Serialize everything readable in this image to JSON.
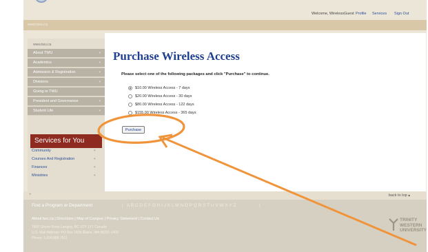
{
  "site": {
    "url_banner": "www.twu.ca",
    "welcome": "Welcome, WirelessGuest",
    "profile_link": "Profile",
    "services_link": "Services",
    "signout_link": "Sign Out"
  },
  "sidebar": {
    "url": "www.twu.ca",
    "items": [
      {
        "label": "About TWU"
      },
      {
        "label": "Academics"
      },
      {
        "label": "Admission & Registration"
      },
      {
        "label": "Divisions"
      },
      {
        "label": "Giving to TWU"
      },
      {
        "label": "President and Governance"
      },
      {
        "label": "Student Life"
      }
    ],
    "services_title": "Services for You",
    "services_items": [
      {
        "label": "Community"
      },
      {
        "label": "Courses And Registration"
      },
      {
        "label": "Finances"
      },
      {
        "label": "Ministries"
      }
    ]
  },
  "main": {
    "title": "Purchase Wireless Access",
    "instruction": "Please select one of the following packages and click \"Purchase\" to continue.",
    "options": [
      {
        "label": "$10.00 Wireless Access - 7 days",
        "selected": true
      },
      {
        "label": "$20.00 Wireless Access - 30 days",
        "selected": false
      },
      {
        "label": "$80.00 Wireless Access - 122 days",
        "selected": false
      },
      {
        "label": "$155.00 Wireless Access - 365 days",
        "selected": false
      }
    ],
    "purchase_label": "Purchase"
  },
  "totop": {
    "plus": "+",
    "back_label": "back to top ▴"
  },
  "footer": {
    "find_label": "Find a Program or Department",
    "separator": "|",
    "letters": "A B C D E F G H I J K L M N O P Q R S T U V W X Y Z",
    "end_separator": "|",
    "links": "About twu.ca | Directions | Map of Campus | Privacy Statement | Contact Us",
    "address1": "7600 Glover Road Langley, BC V2Y 1Y1 Canada",
    "address2": "U.S. Mail Address: PO Box 1409 Blaine, WA 98231-1409",
    "phone": "Phone: 1.604.888.7511",
    "logo_text": [
      "TRINITY",
      "WESTERN",
      "UNIVERSITY"
    ]
  },
  "colors": {
    "annotation": "#f0943c",
    "services_box": "#8e2a1f",
    "title_blue": "#1f3f8f"
  }
}
